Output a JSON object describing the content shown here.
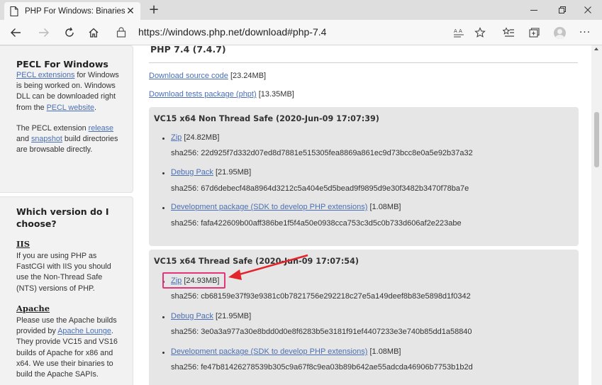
{
  "browser": {
    "tab_title": "PHP For Windows: Binaries and s",
    "url": "https://windows.php.net/download#php-7.4"
  },
  "sidebar": {
    "pecl": {
      "heading": "PECL For Windows",
      "link1": "PECL extensions",
      "text1a": " for Windows is being worked on. Windows DLL can be downloaded right from the ",
      "link2": "PECL website",
      "text1b": ".",
      "text2a": "The PECL extension ",
      "link3": "release",
      "text2b": " and ",
      "link4": "snapshot",
      "text2c": " build directories are browsable directly."
    },
    "which": {
      "heading": "Which version do I choose?",
      "iis_title": "IIS",
      "iis_text": "If you are using PHP as FastCGI with IIS you should use the Non-Thread Safe (NTS) versions of PHP.",
      "apache_title": "Apache",
      "apache_text_a": "Please use the Apache builds provided by ",
      "apache_link": "Apache Lounge",
      "apache_text_b": ". They provide VC15 and VS16 builds of Apache for x86 and x64. We use their binaries to build the Apache SAPIs."
    }
  },
  "main": {
    "release_title": "PHP 7.4 (7.4.7)",
    "source": {
      "link": "Download source code",
      "size": " [23.24MB]"
    },
    "tests": {
      "link": "Download tests package (phpt)",
      "size": " [13.35MB]"
    },
    "builds": [
      {
        "title": "VC15 x64 Non Thread Safe (2020-Jun-09 17:07:39)",
        "items": [
          {
            "link": "Zip",
            "size": " [24.82MB]",
            "sha": "sha256: 22d925f7d332d07ed8d7881e515305fea8869a861ec9d73bcc8e0a5e92b37a32"
          },
          {
            "link": "Debug Pack",
            "size": " [21.95MB]",
            "sha": "sha256: 67d6debecf48a8964d3212c5a404e5d5bead9f9895d9e30f3482b3470f78ba7e"
          },
          {
            "link": "Development package (SDK to develop PHP extensions)",
            "size": " [1.08MB]",
            "sha": "sha256: fafa422609b00aff386be1f5f4a50e0938cca753c3d5c0b733d606af2e223abe"
          }
        ]
      },
      {
        "title": "VC15 x64 Thread Safe (2020-Jun-09 17:07:54)",
        "items": [
          {
            "link": "Zip",
            "size": " [24.93MB]",
            "sha": "sha256: cb68159e37f93e9381c0b7821756e292218c27e5a149deef8b83e5898d1f0342"
          },
          {
            "link": "Debug Pack",
            "size": " [21.95MB]",
            "sha": "sha256: 3e0a3a977a30e8bdd0d0e8f6283b5e3181f91ef4407233e3e740b85dd1a58840"
          },
          {
            "link": "Development package (SDK to develop PHP extensions)",
            "size": " [1.08MB]",
            "sha": "sha256: fe47b81426278539b305c9a67f8c9ea03b89b642ae55adcda46906b7753b1b2d"
          }
        ]
      }
    ]
  },
  "colors": {
    "link": "#4a6fb5",
    "annotation": "#e5357a",
    "arrow": "#e3242b"
  },
  "icons": [
    "page-icon",
    "close-icon",
    "plus-icon",
    "minimize-icon",
    "maximize-icon",
    "back-icon",
    "forward-icon",
    "reload-icon",
    "home-icon",
    "lock-icon",
    "read-aloud-icon",
    "star-icon",
    "favorites-icon",
    "collections-icon",
    "profile-icon",
    "more-icon"
  ]
}
